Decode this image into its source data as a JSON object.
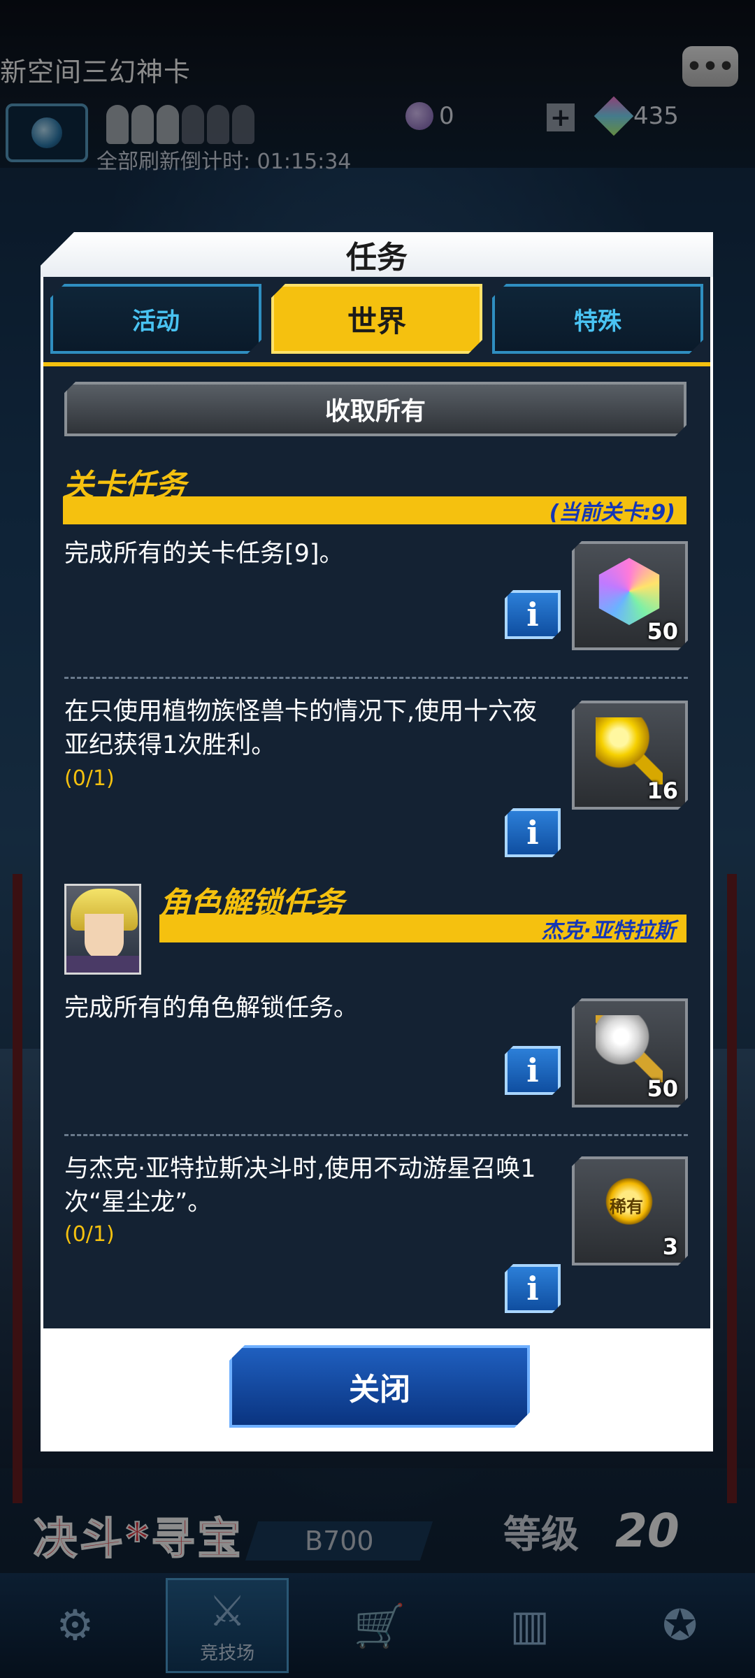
{
  "header": {
    "title": "新空间三幻神卡",
    "countdown_label": "全部刷新倒计时:",
    "countdown_value": "01:15:34",
    "orb_count": "0",
    "gem_count": "435"
  },
  "modal": {
    "title": "任务",
    "tabs": [
      {
        "label": "活动",
        "active": false
      },
      {
        "label": "世界",
        "active": true
      },
      {
        "label": "特殊",
        "active": false
      }
    ],
    "collect_all_label": "收取所有",
    "sections": [
      {
        "title": "关卡任务",
        "subtitle": "(当前关卡:9)",
        "missions": [
          {
            "text": "完成所有的关卡任务[9]。",
            "progress": "",
            "reward_icon": "gem-icon",
            "reward_qty": "50"
          },
          {
            "text": "在只使用植物族怪兽卡的情况下,使用十六夜亚纪获得1次胜利。",
            "progress": "(0/1)",
            "reward_icon": "gold-key-icon",
            "reward_qty": "16"
          }
        ]
      },
      {
        "title": "角色解锁任务",
        "subtitle": "杰克·亚特拉斯",
        "missions": [
          {
            "text": "完成所有的角色解锁任务。",
            "progress": "",
            "reward_icon": "silver-key-icon",
            "reward_qty": "50"
          },
          {
            "text": "与杰克·亚特拉斯决斗时,使用不动游星召唤1次“星尘龙”。",
            "progress": "(0/1)",
            "reward_icon": "rare-medal-icon",
            "reward_qty": "3",
            "reward_label": "稀有"
          }
        ]
      }
    ],
    "info_label": "i",
    "close_label": "关闭"
  },
  "footer": {
    "logo": "决斗*寻宝",
    "b_value": "B700",
    "level_label": "等级",
    "level_value": "20",
    "nav_caption": "竞技场"
  },
  "colors": {
    "accent_yellow": "#f5c10f",
    "panel_bg": "#142233",
    "tab_blue": "#49c3f2",
    "subtitle_blue": "#1436b5"
  }
}
